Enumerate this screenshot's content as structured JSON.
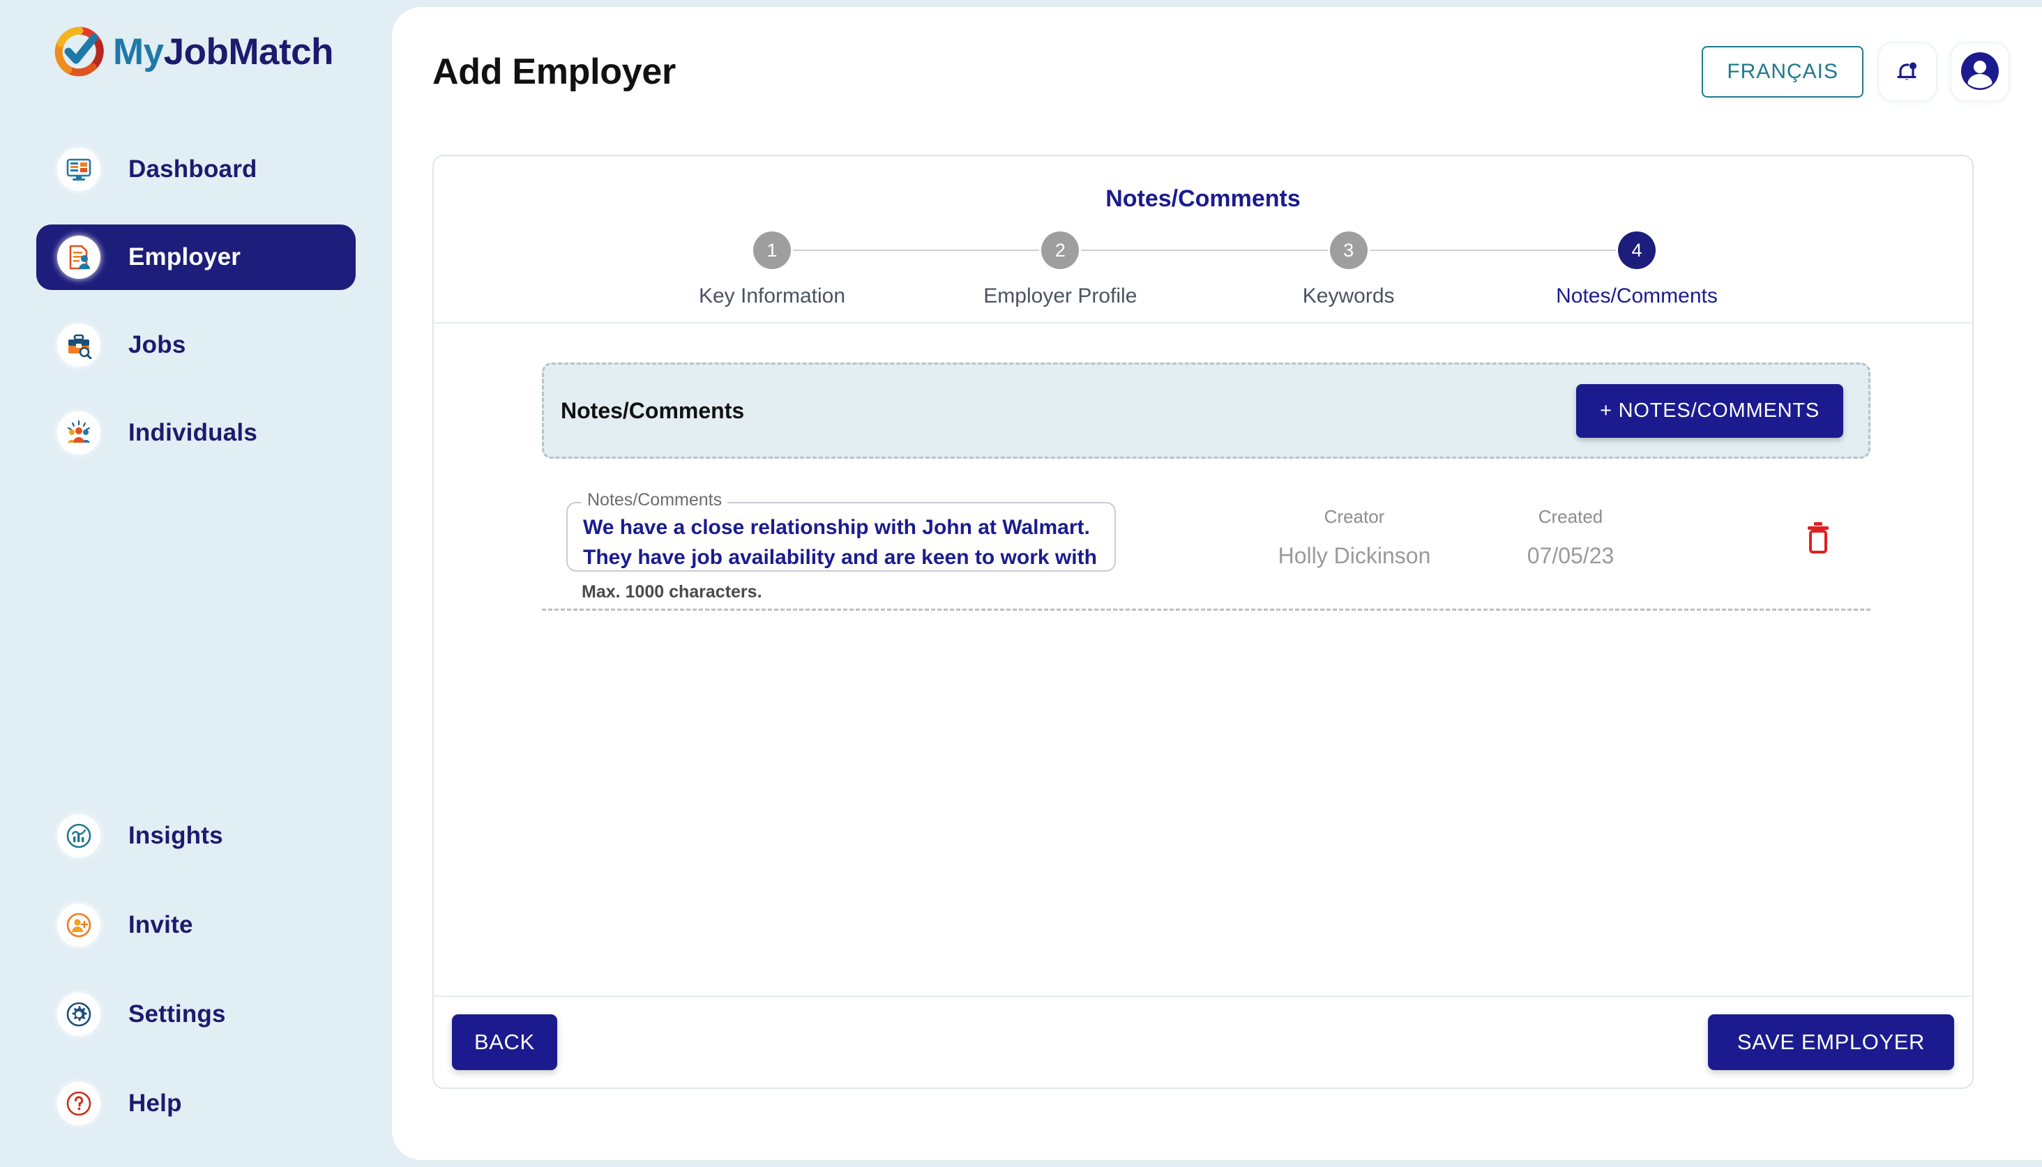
{
  "brand": {
    "name_part1": "My",
    "name_part2": "JobMatch",
    "logo_icon": "check-circle-logo-icon"
  },
  "sidebar": {
    "primary_items": [
      {
        "label": "Dashboard",
        "icon": "dashboard-monitor-icon",
        "active": false
      },
      {
        "label": "Employer",
        "icon": "employer-document-person-icon",
        "active": true
      },
      {
        "label": "Jobs",
        "icon": "briefcase-search-icon",
        "active": false
      },
      {
        "label": "Individuals",
        "icon": "people-group-icon",
        "active": false
      }
    ],
    "secondary_items": [
      {
        "label": "Insights",
        "icon": "insights-chart-icon",
        "active": false
      },
      {
        "label": "Invite",
        "icon": "invite-person-plus-icon",
        "active": false
      },
      {
        "label": "Settings",
        "icon": "gear-icon",
        "active": false
      },
      {
        "label": "Help",
        "icon": "question-mark-icon",
        "active": false
      }
    ]
  },
  "header": {
    "title": "Add Employer",
    "language_button": "FRANÇAIS",
    "notifications_icon": "bell-icon",
    "avatar_icon": "user-avatar-icon"
  },
  "wizard": {
    "heading": "Notes/Comments",
    "steps": [
      {
        "number": "1",
        "label": "Key Information",
        "current": false
      },
      {
        "number": "2",
        "label": "Employer Profile",
        "current": false
      },
      {
        "number": "3",
        "label": "Keywords",
        "current": false
      },
      {
        "number": "4",
        "label": "Notes/Comments",
        "current": true
      }
    ],
    "add_section": {
      "title": "Notes/Comments",
      "add_button": "+ NOTES/COMMENTS"
    },
    "note_rows": [
      {
        "field_label": "Notes/Comments",
        "value": "We have a close relationship with John at Walmart. They have job availability and are keen to work with us.",
        "helper": "Max. 1000 characters.",
        "creator_label": "Creator",
        "creator_value": "Holly  Dickinson",
        "created_label": "Created",
        "created_value": "07/05/23",
        "delete_icon": "trash-icon"
      }
    ],
    "footer": {
      "back_button": "BACK",
      "save_button": "SAVE EMPLOYER"
    }
  },
  "colors": {
    "page_background": "#e1eef4",
    "panel_background": "#ffffff",
    "brand_navy": "#1b1b8f",
    "sidebar_active": "#1d1d7c",
    "teal": "#1d7a8c",
    "delete_red": "#e02020",
    "step_inactive": "#9e9e9e",
    "notes_box_background": "#e2eef2"
  }
}
